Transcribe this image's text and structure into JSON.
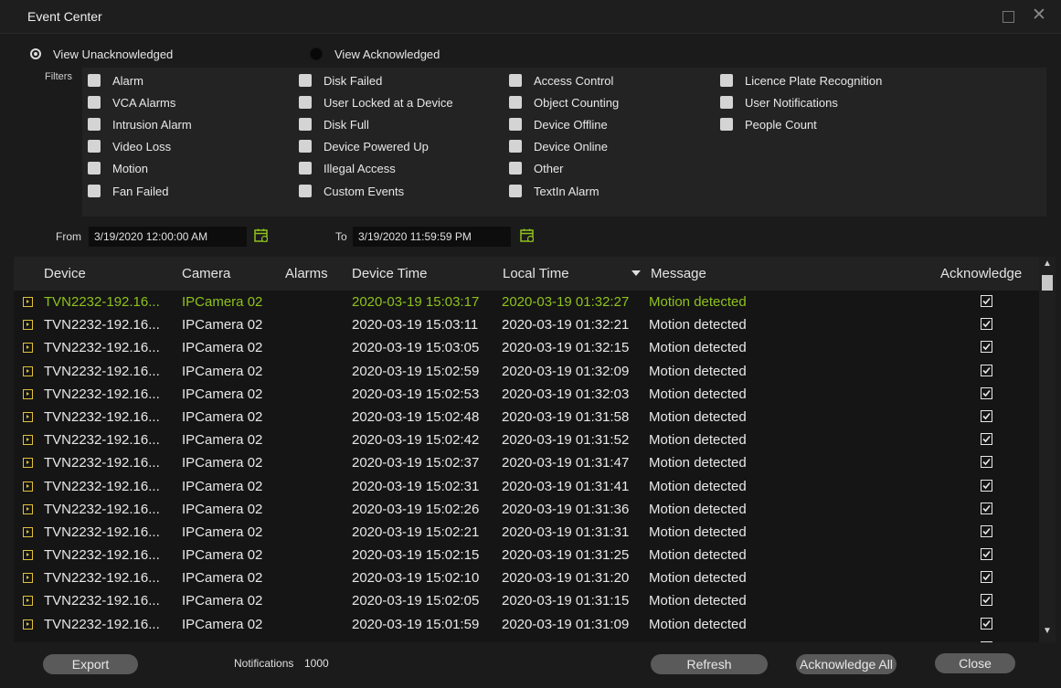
{
  "window": {
    "title": "Event Center"
  },
  "view": {
    "unacknowledged_label": "View Unacknowledged",
    "acknowledged_label": "View Acknowledged",
    "selected": "unacknowledged"
  },
  "filters": {
    "label": "Filters",
    "items": [
      "Alarm",
      "VCA Alarms",
      "Intrusion Alarm",
      "Video Loss",
      "Motion",
      "Fan Failed",
      "Disk Failed",
      "User Locked at a Device",
      "Disk Full",
      "Device Powered Up",
      "Illegal Access",
      "Custom Events",
      "Access Control",
      "Object Counting",
      "Device Offline",
      "Device Online",
      "Other",
      "TextIn Alarm",
      "Licence Plate Recognition",
      "User Notifications",
      "People Count"
    ]
  },
  "date_range": {
    "from_label": "From",
    "from_value": "3/19/2020 12:00:00 AM",
    "to_label": "To",
    "to_value": "3/19/2020 11:59:59 PM"
  },
  "table": {
    "columns": {
      "device": "Device",
      "camera": "Camera",
      "alarms": "Alarms",
      "device_time": "Device Time",
      "local_time": "Local Time",
      "message": "Message",
      "acknowledge": "Acknowledge"
    },
    "sort_column": "Message",
    "rows": [
      {
        "device": "TVN2232-192.16...",
        "camera": "IPCamera 02",
        "device_time": "2020-03-19 15:03:17",
        "local_time": "2020-03-19 01:32:27",
        "message": "Motion detected",
        "ack": true
      },
      {
        "device": "TVN2232-192.16...",
        "camera": "IPCamera 02",
        "device_time": "2020-03-19 15:03:11",
        "local_time": "2020-03-19 01:32:21",
        "message": "Motion detected",
        "ack": true
      },
      {
        "device": "TVN2232-192.16...",
        "camera": "IPCamera 02",
        "device_time": "2020-03-19 15:03:05",
        "local_time": "2020-03-19 01:32:15",
        "message": "Motion detected",
        "ack": true
      },
      {
        "device": "TVN2232-192.16...",
        "camera": "IPCamera 02",
        "device_time": "2020-03-19 15:02:59",
        "local_time": "2020-03-19 01:32:09",
        "message": "Motion detected",
        "ack": true
      },
      {
        "device": "TVN2232-192.16...",
        "camera": "IPCamera 02",
        "device_time": "2020-03-19 15:02:53",
        "local_time": "2020-03-19 01:32:03",
        "message": "Motion detected",
        "ack": true
      },
      {
        "device": "TVN2232-192.16...",
        "camera": "IPCamera 02",
        "device_time": "2020-03-19 15:02:48",
        "local_time": "2020-03-19 01:31:58",
        "message": "Motion detected",
        "ack": true
      },
      {
        "device": "TVN2232-192.16...",
        "camera": "IPCamera 02",
        "device_time": "2020-03-19 15:02:42",
        "local_time": "2020-03-19 01:31:52",
        "message": "Motion detected",
        "ack": true
      },
      {
        "device": "TVN2232-192.16...",
        "camera": "IPCamera 02",
        "device_time": "2020-03-19 15:02:37",
        "local_time": "2020-03-19 01:31:47",
        "message": "Motion detected",
        "ack": true
      },
      {
        "device": "TVN2232-192.16...",
        "camera": "IPCamera 02",
        "device_time": "2020-03-19 15:02:31",
        "local_time": "2020-03-19 01:31:41",
        "message": "Motion detected",
        "ack": true
      },
      {
        "device": "TVN2232-192.16...",
        "camera": "IPCamera 02",
        "device_time": "2020-03-19 15:02:26",
        "local_time": "2020-03-19 01:31:36",
        "message": "Motion detected",
        "ack": true
      },
      {
        "device": "TVN2232-192.16...",
        "camera": "IPCamera 02",
        "device_time": "2020-03-19 15:02:21",
        "local_time": "2020-03-19 01:31:31",
        "message": "Motion detected",
        "ack": true
      },
      {
        "device": "TVN2232-192.16...",
        "camera": "IPCamera 02",
        "device_time": "2020-03-19 15:02:15",
        "local_time": "2020-03-19 01:31:25",
        "message": "Motion detected",
        "ack": true
      },
      {
        "device": "TVN2232-192.16...",
        "camera": "IPCamera 02",
        "device_time": "2020-03-19 15:02:10",
        "local_time": "2020-03-19 01:31:20",
        "message": "Motion detected",
        "ack": true
      },
      {
        "device": "TVN2232-192.16...",
        "camera": "IPCamera 02",
        "device_time": "2020-03-19 15:02:05",
        "local_time": "2020-03-19 01:31:15",
        "message": "Motion detected",
        "ack": true
      },
      {
        "device": "TVN2232-192.16...",
        "camera": "IPCamera 02",
        "device_time": "2020-03-19 15:01:59",
        "local_time": "2020-03-19 01:31:09",
        "message": "Motion detected",
        "ack": true
      }
    ]
  },
  "footer": {
    "export_label": "Export",
    "notifications_label": "Notifications",
    "notifications_count": "1000",
    "refresh_label": "Refresh",
    "acknowledge_all_label": "Acknowledge All",
    "close_label": "Close"
  },
  "colors": {
    "selected_row_text": "#8ec21c",
    "background": "#1b1b1b",
    "button": "#5a5a5a",
    "play_icon": "#e0c23a",
    "calendar_icon": "#8ec21c"
  }
}
